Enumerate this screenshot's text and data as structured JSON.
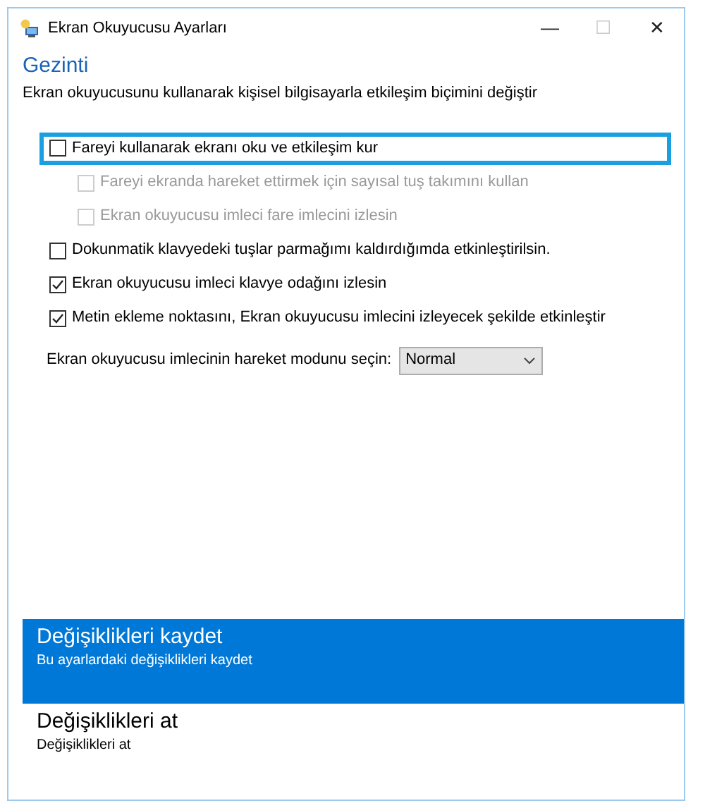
{
  "window": {
    "title": "Ekran Okuyucusu Ayarları",
    "controls": [
      "—",
      "☐",
      "✕"
    ]
  },
  "heading": "Gezinti",
  "description": "Ekran okuyucusunu kullanarak kişisel bilgisayarla etkileşim biçimini değiştir",
  "options": [
    {
      "label": "Fareyi kullanarak ekranı oku ve etkileşim kur",
      "checked": false,
      "disabled": false,
      "focused": true,
      "children": [
        {
          "label": "Fareyi ekranda hareket ettirmek için sayısal tuş takımını kullan",
          "checked": false,
          "disabled": true,
          "focused": false
        },
        {
          "label": "Ekran okuyucusu imleci fare imlecini izlesin",
          "checked": false,
          "disabled": true,
          "focused": false
        }
      ]
    },
    {
      "label": "Dokunmatik klavyedeki tuşlar parmağımı kaldırdığımda etkinleştirilsin.",
      "checked": false,
      "disabled": false,
      "focused": false
    },
    {
      "label": "Ekran okuyucusu imleci klavye odağını izlesin",
      "checked": true,
      "disabled": false,
      "focused": false
    },
    {
      "label": "Metin ekleme noktasını, Ekran okuyucusu imlecini izleyecek şekilde etkinleştir",
      "checked": true,
      "disabled": false,
      "focused": false
    }
  ],
  "mode": {
    "label": "Ekran okuyucusu imlecinin hareket modunu seçin:",
    "value": "Normal"
  },
  "actions": [
    {
      "title": "Değişiklikleri kaydet",
      "subtitle": "Bu ayarlardaki değişiklikleri kaydet",
      "selected": true
    },
    {
      "title": "Değişiklikleri at",
      "subtitle": "Değişiklikleri at",
      "selected": false
    }
  ]
}
